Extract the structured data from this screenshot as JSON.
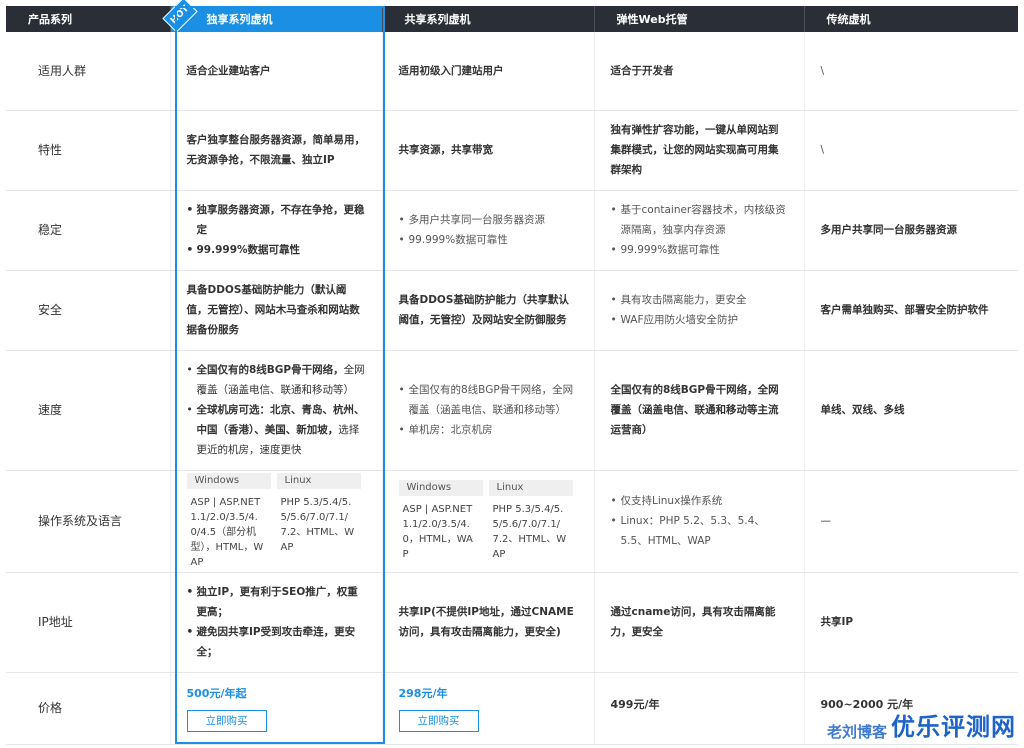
{
  "header": {
    "col0": "产品系列",
    "col1": "独享系列虚机",
    "col2": "共享系列虚机",
    "col3": "弹性Web托管",
    "col4": "传统虚机",
    "hot": "HOT"
  },
  "rows": {
    "audience": {
      "label": "适用人群",
      "c1": "适合企业建站客户",
      "c2": "适用初级入门建站用户",
      "c3": "适合于开发者",
      "c4": "\\"
    },
    "feature": {
      "label": "特性",
      "c1": "客户独享整台服务器资源，简单易用，无资源争抢，不限流量、独立IP",
      "c2": "共享资源，共享带宽",
      "c3": "独有弹性扩容功能，一键从单网站到集群模式，让您的网站实现高可用集群架构",
      "c4": "\\"
    },
    "stable": {
      "label": "稳定",
      "c1": [
        "独享服务器资源，不存在争抢，更稳定",
        "99.999%数据可靠性"
      ],
      "c2": [
        "多用户共享同一台服务器资源",
        "99.999%数据可靠性"
      ],
      "c3": [
        "基于container容器技术，内核级资源隔离，独享内存资源",
        "99.999%数据可靠性"
      ],
      "c4": "多用户共享同一台服务器资源"
    },
    "security": {
      "label": "安全",
      "c1": "具备DDOS基础防护能力（默认阈值，无管控）、网站木马查杀和网站数据备份服务",
      "c2": "具备DDOS基础防护能力（共享默认阈值，无管控）及网站安全防御服务",
      "c3": [
        "具有攻击隔离能力，更安全",
        "WAF应用防火墙安全防护"
      ],
      "c4": "客户需单独购买、部署安全防护软件"
    },
    "speed": {
      "label": "速度",
      "c1": [
        {
          "bold": "全国仅有的8线BGP骨干网络，",
          "rest": "全网覆盖（涵盖电信、联通和移动等）"
        },
        {
          "bold": "全球机房可选：北京、青岛、杭州、中国（香港）、美国、新加坡，",
          "rest": "选择更近的机房，速度更快"
        }
      ],
      "c2": [
        "全国仅有的8线BGP骨干网络，全网覆盖（涵盖电信、联通和移动等）",
        "单机房：北京机房"
      ],
      "c3": "全国仅有的8线BGP骨干网络，全网覆盖（涵盖电信、联通和移动等主流运营商）",
      "c4": "单线、双线、多线"
    },
    "os": {
      "label": "操作系统及语言",
      "c1": {
        "win_head": "Windows",
        "linux_head": "Linux",
        "win": "ASP | ASP.NET 1.1/2.0/3.5/4.0/4.5（部分机型），HTML，WAP",
        "linux": "PHP 5.3/5.4/5.5/5.6/7.0/7.1/7.2、HTML、WAP"
      },
      "c2": {
        "win_head": "Windows",
        "linux_head": "Linux",
        "win": "ASP | ASP.NET1.1/2.0/3.5/4.0，HTML，WAP",
        "linux": "PHP 5.3/5.4/5.5/5.6/7.0/7.1/7.2、HTML、WAP"
      },
      "c3": [
        "仅支持Linux操作系统",
        "Linux：PHP 5.2、5.3、5.4、5.5、HTML、WAP"
      ],
      "c4": "—"
    },
    "ip": {
      "label": "IP地址",
      "c1": [
        "独立IP，更有利于SEO推广，权重更高；",
        "避免因共享IP受到攻击牵连，更安全；"
      ],
      "c2": "共享IP(不提供IP地址，通过CNAME访问，具有攻击隔离能力，更安全)",
      "c3": "通过cname访问，具有攻击隔离能力，更安全",
      "c4": "共享IP"
    },
    "price": {
      "label": "价格",
      "c1": "500元/年起",
      "c2": "298元/年",
      "c3": "499元/年",
      "c4": "900~2000 元/年",
      "buy": "立即购买"
    }
  },
  "watermark": {
    "small": "老刘博客",
    "big": "优乐评测网"
  },
  "colors": {
    "accent": "#1a8fe3",
    "header_bg": "#2a2f37"
  }
}
